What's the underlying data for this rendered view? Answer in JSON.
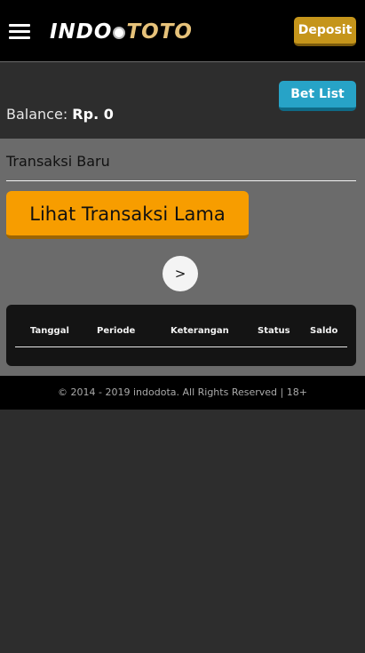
{
  "header": {
    "menu_icon": "hamburger-menu-icon",
    "logo": {
      "part1": "INDO",
      "part2": "TOTO"
    },
    "deposit_label": "Deposit"
  },
  "account": {
    "betlist_label": "Bet List",
    "balance_label": "Balance:",
    "balance_value": "Rp. 0"
  },
  "transactions": {
    "title": "Transaksi Baru",
    "old_button_label": "Lihat Transaksi Lama",
    "next_label": ">",
    "columns": [
      "Tanggal",
      "Periode",
      "Keterangan",
      "Status",
      "Saldo"
    ],
    "rows": []
  },
  "footer": {
    "text": "© 2014 - 2019 indodota. All Rights Reserved | 18+"
  },
  "colors": {
    "deposit": "#c5951b",
    "betlist": "#27a3c7",
    "old_button": "#f79d00"
  }
}
